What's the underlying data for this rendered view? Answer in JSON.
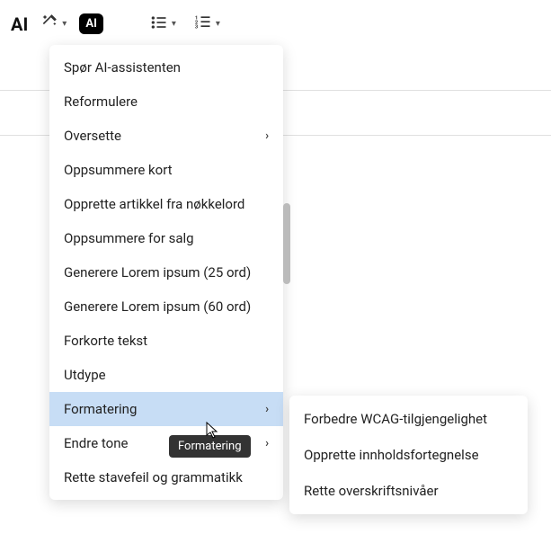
{
  "toolbar": {
    "ai_label": "AI",
    "ai_badge": "AI"
  },
  "menu": {
    "items": [
      {
        "label": "Spør AI-assistenten",
        "has_submenu": false
      },
      {
        "label": "Reformulere",
        "has_submenu": false
      },
      {
        "label": "Oversette",
        "has_submenu": true
      },
      {
        "label": "Oppsummere kort",
        "has_submenu": false
      },
      {
        "label": "Opprette artikkel fra nøkkelord",
        "has_submenu": false
      },
      {
        "label": "Oppsummere for salg",
        "has_submenu": false
      },
      {
        "label": "Generere Lorem ipsum (25 ord)",
        "has_submenu": false
      },
      {
        "label": "Generere Lorem ipsum (60 ord)",
        "has_submenu": false
      },
      {
        "label": "Forkorte tekst",
        "has_submenu": false
      },
      {
        "label": "Utdype",
        "has_submenu": false
      },
      {
        "label": "Formatering",
        "has_submenu": true,
        "highlighted": true
      },
      {
        "label": "Endre tone",
        "has_submenu": true
      },
      {
        "label": "Rette stavefeil og grammatikk",
        "has_submenu": false
      }
    ]
  },
  "tooltip": {
    "text": "Formatering"
  },
  "submenu": {
    "items": [
      {
        "label": "Forbedre WCAG-tilgjengelighet"
      },
      {
        "label": "Opprette innholdsfortegnelse"
      },
      {
        "label": "Rette overskriftsnivåer"
      }
    ]
  }
}
